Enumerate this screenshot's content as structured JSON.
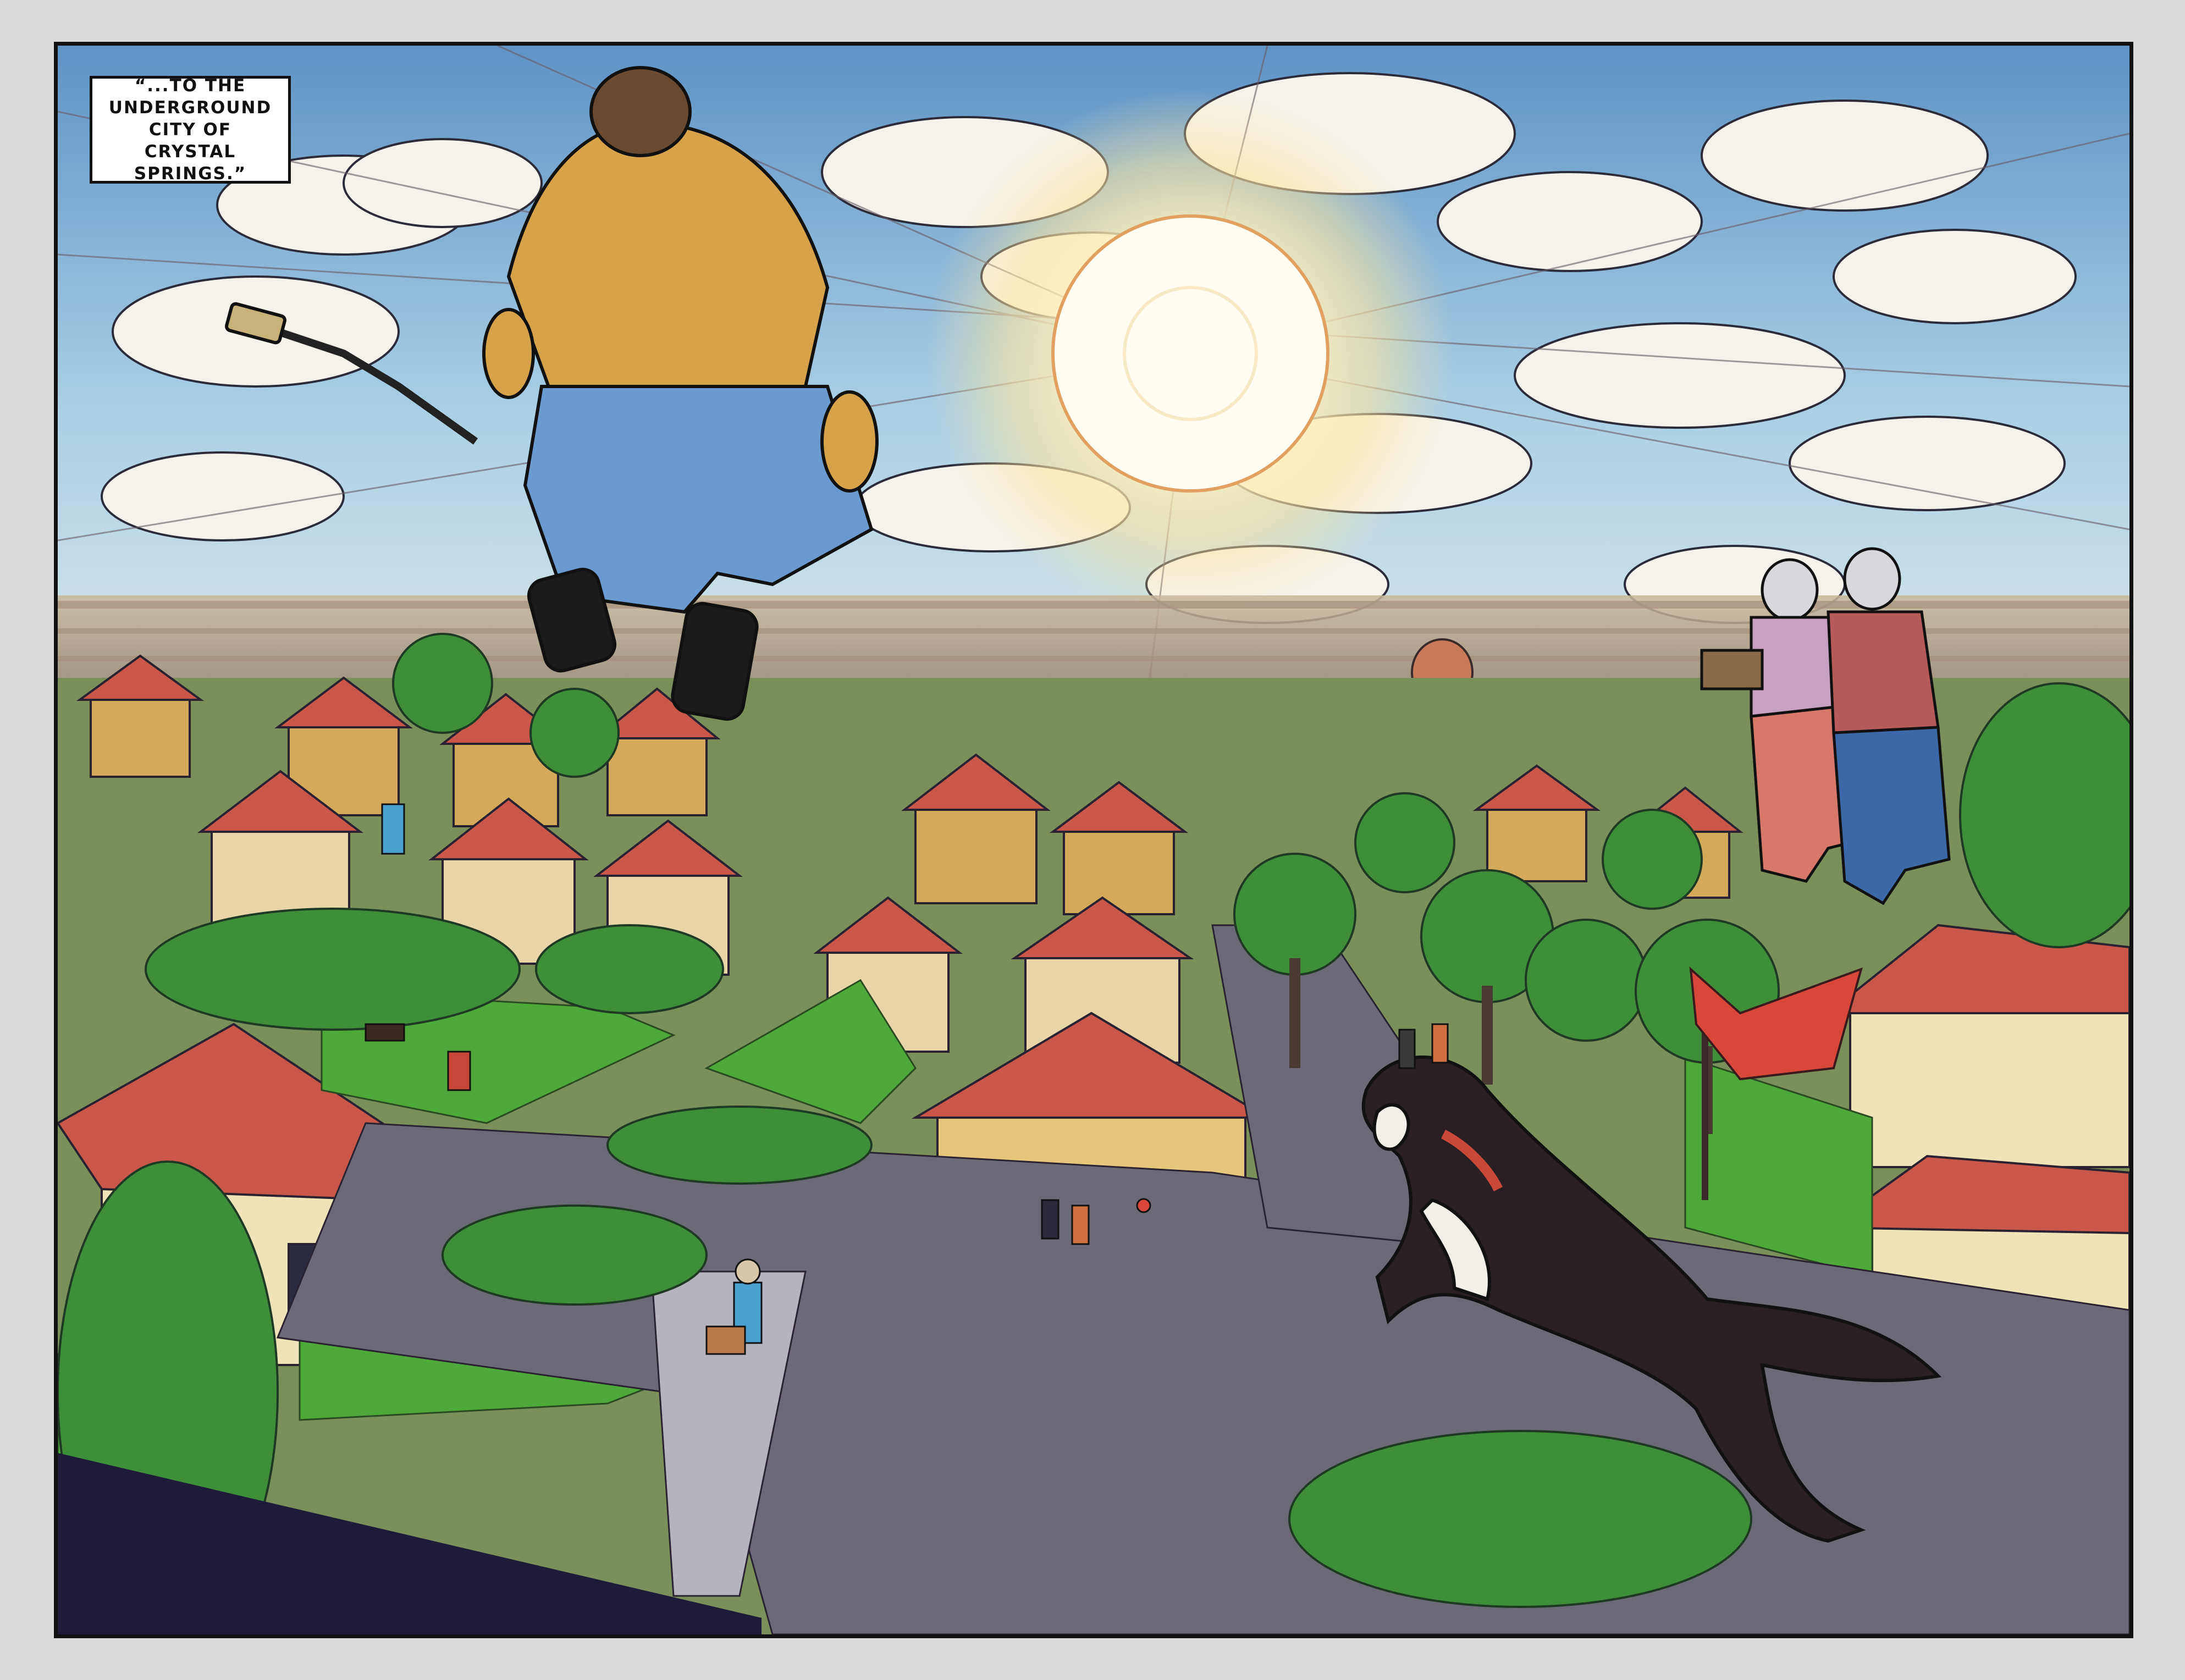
{
  "caption": {
    "text": "“...TO THE UNDERGROUND CITY OF CRYSTAL SPRINGS.”"
  },
  "colors": {
    "page_background": "#dcdcdc",
    "panel_border": "#111111",
    "sky": "#6fa3cf",
    "sun": "#fff8d8",
    "roof": "#c9584a",
    "lawn": "#4fa83a",
    "street": "#6b6a76",
    "dog": "#2a1f22"
  },
  "scene": {
    "subjects": [
      "flying-man-icon",
      "flying-couple-icon",
      "leaping-dog-icon",
      "sun-icon",
      "suburban-houses-icon",
      "street-icon",
      "red-flag-icon"
    ]
  }
}
